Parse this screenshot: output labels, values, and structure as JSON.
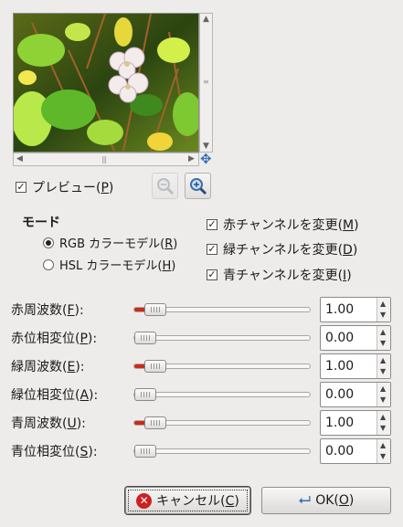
{
  "preview": {
    "checkbox_checked": true,
    "label_main": "プレビュー(",
    "label_mnemonic": "P",
    "label_tail": ")"
  },
  "mode": {
    "title": "モード",
    "options": [
      {
        "label_main": "RGB カラーモデル(",
        "mnemonic": "R",
        "tail": ")",
        "selected": true
      },
      {
        "label_main": "HSL カラーモデル(",
        "mnemonic": "H",
        "tail": ")",
        "selected": false
      }
    ]
  },
  "channels": [
    {
      "label_main": "赤チャンネルを変更(",
      "mnemonic": "M",
      "tail": ")",
      "checked": true
    },
    {
      "label_main": "緑チャンネルを変更(",
      "mnemonic": "D",
      "tail": ")",
      "checked": true
    },
    {
      "label_main": "青チャンネルを変更(",
      "mnemonic": "I",
      "tail": ")",
      "checked": true
    }
  ],
  "sliders": [
    {
      "label_main": "赤周波数(",
      "mnemonic": "F",
      "tail": "):",
      "value": "1.00",
      "fraction": 0.0625
    },
    {
      "label_main": "赤位相変位(",
      "mnemonic": "P",
      "tail": "):",
      "value": "0.00",
      "fraction": 0.0
    },
    {
      "label_main": "緑周波数(",
      "mnemonic": "E",
      "tail": "):",
      "value": "1.00",
      "fraction": 0.0625
    },
    {
      "label_main": "緑位相変位(",
      "mnemonic": "A",
      "tail": "):",
      "value": "0.00",
      "fraction": 0.0
    },
    {
      "label_main": "青周波数(",
      "mnemonic": "U",
      "tail": "):",
      "value": "1.00",
      "fraction": 0.0625
    },
    {
      "label_main": "青位相変位(",
      "mnemonic": "S",
      "tail": "):",
      "value": "0.00",
      "fraction": 0.0
    }
  ],
  "buttons": {
    "cancel": {
      "label_main": "キャンセル(",
      "mnemonic": "C",
      "tail": ")",
      "icon": "cancel-icon"
    },
    "ok": {
      "label_main": "OK(",
      "mnemonic": "O",
      "tail": ")",
      "icon": "ok-arrow-icon"
    }
  },
  "icons": {
    "zoom_out": "zoom-out-icon",
    "zoom_in": "zoom-in-icon",
    "navigate": "navigate-icon"
  },
  "colors": {
    "slider_fill": "#cc2a1a",
    "cancel_icon": "#cc2121",
    "ok_icon": "#3a6fb0"
  }
}
